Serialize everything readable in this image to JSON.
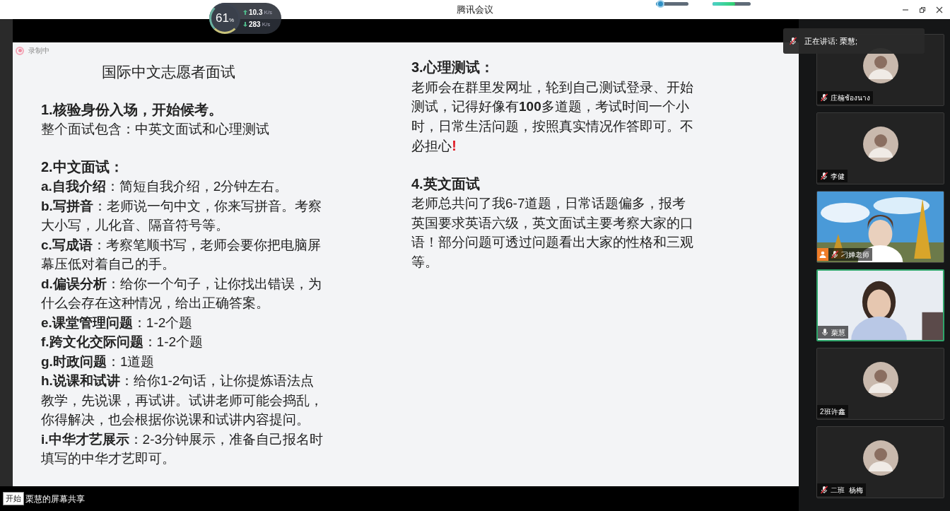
{
  "window": {
    "title": "腾讯会议"
  },
  "network": {
    "percent": "61",
    "percent_unit": "%",
    "upload": "10.3",
    "upload_unit": "K/s",
    "download": "283",
    "download_unit": "K/s"
  },
  "meters": [
    {
      "kind": "slider",
      "level": 0.12
    },
    {
      "kind": "meter",
      "level": 0.6
    }
  ],
  "recording": {
    "label": "录制中"
  },
  "slide": {
    "title": "国际中文志愿者面试",
    "left": [
      {
        "kind": "heading",
        "text": "1.核验身份入场，开始候考。"
      },
      {
        "kind": "para",
        "text": "整个面试包含：中英文面试和心理测试"
      },
      {
        "kind": "gap"
      },
      {
        "kind": "heading",
        "text": "2.中文面试："
      },
      {
        "kind": "para",
        "text": "**a.自我介绍**：简短自我介绍，2分钟左右。"
      },
      {
        "kind": "para",
        "text": "**b.写拼音**：老师说一句中文，你来写拼音。考察大小写，儿化音、隔音符号等。"
      },
      {
        "kind": "para",
        "text": "**c.写成语**：考察笔顺书写，老师会要你把电脑屏幕压低对着自己的手。"
      },
      {
        "kind": "para",
        "text": "**d.偏误分析**：给你一个句子，让你找出错误，为什么会存在这种情况，给出正确答案。"
      },
      {
        "kind": "para",
        "text": "**e.课堂管理问题**：1-2个题"
      },
      {
        "kind": "para",
        "text": "**f.跨文化交际问题**：1-2个题"
      },
      {
        "kind": "para",
        "text": "**g.时政问题**：1道题"
      },
      {
        "kind": "para",
        "text": "**h.说课和试讲**：给你1-2句话，让你提炼语法点教学，先说课，再试讲。试讲老师可能会捣乱，你得解决，也会根据你说课和试讲内容提问。"
      },
      {
        "kind": "para",
        "text": "**i.中华才艺展示**：2-3分钟展示，准备自己报名时填写的中华才艺即可。"
      }
    ],
    "right": [
      {
        "kind": "heading",
        "text": "3.心理测试："
      },
      {
        "kind": "para",
        "text": "老师会在群里发网址，轮到自己测试登录、开始测试，记得好像有**100**多道题，考试时间一个小时，日常生活问题，按照真实情况作答即可。不必担心",
        "emphasis": "!"
      },
      {
        "kind": "gap"
      },
      {
        "kind": "heading",
        "text": "4.英文面试"
      },
      {
        "kind": "para",
        "text": "老师总共问了我6-7道题，日常话题偏多，报考英国要求英语六级，英文面试主要考察大家的口语！部分问题可透过问题看出大家的性格和三观等。"
      }
    ]
  },
  "speaking": {
    "text": "正在讲话: 栗慧;"
  },
  "participants": [
    {
      "name": "庄楠ช้องนาง",
      "kind": "avatar",
      "mic": true,
      "muted": true,
      "host": false,
      "active": false
    },
    {
      "name": "李健",
      "kind": "avatar",
      "mic": true,
      "muted": true,
      "host": false,
      "active": false
    },
    {
      "name": "刁婵老师",
      "kind": "video",
      "mic": true,
      "muted": true,
      "host": true,
      "active": false
    },
    {
      "name": "栗慧",
      "kind": "video",
      "mic": true,
      "muted": false,
      "host": false,
      "active": true
    },
    {
      "name": "2班许鑫",
      "kind": "avatar",
      "mic": false,
      "host": false,
      "active": false
    },
    {
      "name": "二班  杨梅",
      "kind": "avatar",
      "mic": true,
      "muted": true,
      "host": false,
      "active": false
    }
  ],
  "status_bar": {
    "start_label": "开始",
    "share_text": "栗慧的屏幕共享"
  }
}
